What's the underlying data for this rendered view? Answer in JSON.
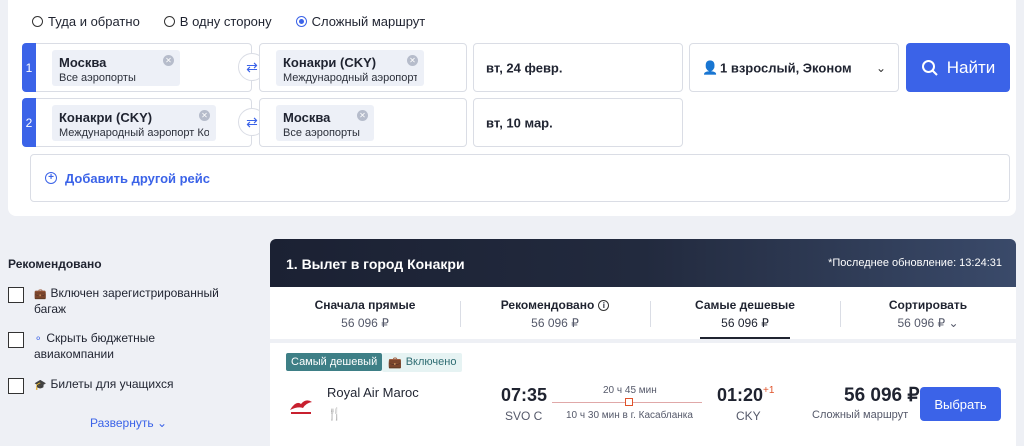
{
  "search": {
    "trip_types": [
      "Туда и обратно",
      "В одну сторону",
      "Сложный маршрут"
    ],
    "selected_trip_type": 2,
    "segments": [
      {
        "number": "1",
        "from_city": "Москва",
        "from_sub": "Все аэропорты",
        "to_city": "Конакри (CKY)",
        "to_sub": "Международный аэропорт Кон...",
        "date": "вт, 24 февр."
      },
      {
        "number": "2",
        "from_city": "Конакри (CKY)",
        "from_sub": "Международный аэропорт Кон...",
        "to_city": "Москва",
        "to_sub": "Все аэропорты",
        "date": "вт, 10 мар."
      }
    ],
    "passengers": "1 взрослый, Эконом",
    "search_button": "Найти",
    "add_flight": "Добавить другой рейс"
  },
  "filters": {
    "title": "Рекомендовано",
    "items": [
      {
        "label": "Включен зарегистрированный багаж",
        "icon": "luggage-icon"
      },
      {
        "label": "Скрыть бюджетные авиакомпании",
        "icon": "tag-icon"
      },
      {
        "label": "Билеты для учащихся",
        "icon": "graduation-cap-icon"
      }
    ],
    "expand": "Развернуть"
  },
  "results": {
    "title": "1. Вылет в город Конакри",
    "last_update": "*Последнее обновление: 13:24:31",
    "sort_tabs": [
      {
        "label": "Сначала прямые",
        "price": "56 096 ₽"
      },
      {
        "label": "Рекомендовано",
        "price": "56 096 ₽"
      },
      {
        "label": "Самые дешевые",
        "price": "56 096 ₽"
      },
      {
        "label": "Сортировать",
        "price": "56 096 ₽"
      }
    ],
    "active_sort": 2,
    "card": {
      "badge_cheapest": "Самый дешевый",
      "badge_included": "Включено",
      "airline": "Royal Air Maroc",
      "dep_time": "07:35",
      "dep_code": "SVO C",
      "duration": "20 ч 45 мин",
      "stop_info": "10 ч 30 мин в г. Касабланка",
      "arr_time": "01:20",
      "arr_day_offset": "+1",
      "arr_code": "CKY",
      "price": "56 096 ₽",
      "price_type": "Сложный маршрут",
      "select_button": "Выбрать"
    }
  },
  "colors": {
    "accent": "#3b63e8",
    "badge_teal": "#3e7f86",
    "stop_orange": "#e0522a",
    "header_dark": "#1b2133"
  }
}
